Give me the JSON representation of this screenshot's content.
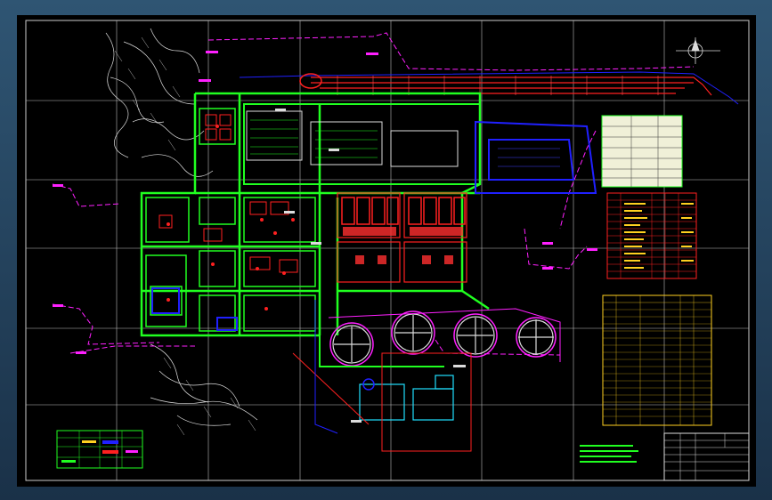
{
  "drawing": {
    "title_block": {
      "title_1": "",
      "title_2": ""
    }
  },
  "colors": {
    "background": "#000000",
    "frame": "#3a6688",
    "green": "#20ff20",
    "red": "#ff2020",
    "blue": "#2020ff",
    "magenta": "#ff20ff",
    "white": "#f0f0f0",
    "cyan": "#20e0ff",
    "table_bg": "#f0f0d8"
  }
}
